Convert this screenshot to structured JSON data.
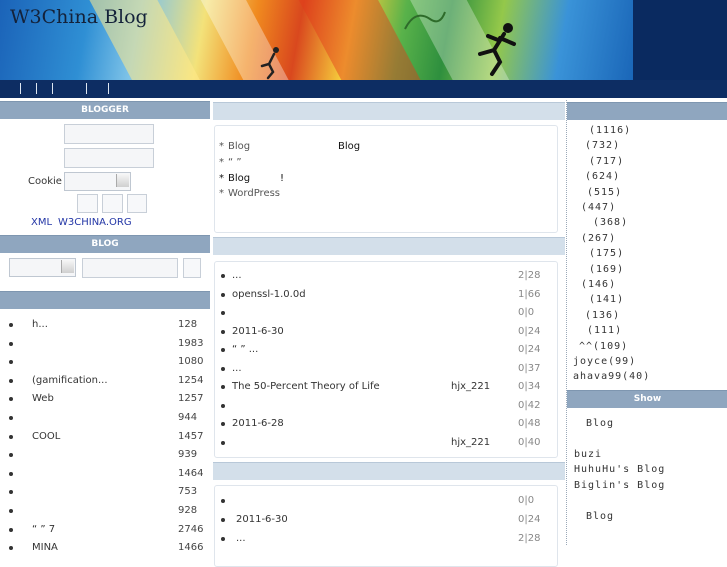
{
  "header": {
    "title": "W3China  Blog",
    "nav_separators": 5
  },
  "blogger": {
    "heading": "BLOGGER",
    "cookie_label": "Cookie",
    "xml_link": "XML",
    "site_link": "W3CHINA.ORG"
  },
  "blog_search": {
    "heading": "BLOG"
  },
  "left_list": [
    {
      "text": "h...",
      "count": "128"
    },
    {
      "text": "",
      "count": "1983"
    },
    {
      "text": "",
      "count": "1080"
    },
    {
      "text": "(gamification...",
      "count": "1254"
    },
    {
      "text": "Web",
      "count": "1257"
    },
    {
      "text": "",
      "count": "944"
    },
    {
      "text": "COOL",
      "count": "1457"
    },
    {
      "text": "",
      "count": "939"
    },
    {
      "text": "",
      "count": "1464"
    },
    {
      "text": "",
      "count": "753"
    },
    {
      "text": "",
      "count": "928"
    },
    {
      "text": "“  ” 7",
      "count": "2746"
    },
    {
      "text": "MINA",
      "count": "1466"
    }
  ],
  "notice": {
    "lines": [
      {
        "bullet": "*",
        "a": "Blog",
        "b": "Blog"
      },
      {
        "bullet": "*",
        "a": "“     ”",
        "b": ""
      },
      {
        "bullet": "*",
        "a": "Blog",
        "b": "!"
      },
      {
        "bullet": "*",
        "a": "WordPress",
        "b": ""
      }
    ]
  },
  "articles": [
    {
      "title": "...",
      "author": "",
      "stats": "2|28"
    },
    {
      "title": "openssl-1.0.0d",
      "author": "",
      "stats": "1|66"
    },
    {
      "title": "",
      "author": "",
      "stats": "0|0"
    },
    {
      "title": "2011-6-30",
      "author": "",
      "stats": "0|24"
    },
    {
      "title": "“  ”      ...",
      "author": "",
      "stats": "0|24"
    },
    {
      "title": "...",
      "author": "",
      "stats": "0|37"
    },
    {
      "title": "The 50-Percent Theory of Life",
      "author": "hjx_221",
      "stats": "0|34"
    },
    {
      "title": "",
      "author": "",
      "stats": "0|42"
    },
    {
      "title": "2011-6-28",
      "author": "",
      "stats": "0|48"
    },
    {
      "title": "",
      "author": "hjx_221",
      "stats": "0|40"
    }
  ],
  "articles2": [
    {
      "title": "",
      "stats": "0|0"
    },
    {
      "title": "2011-6-30",
      "stats": "0|24"
    },
    {
      "title": "...",
      "stats": "2|28"
    }
  ],
  "rank": [
    "(1116)",
    "(732)",
    "(717)",
    "(624)",
    "(515)",
    "(447)",
    "(368)",
    "(267)",
    "(175)",
    "(169)",
    "(146)",
    "(141)",
    "(136)",
    "(111)",
    "^^(109)",
    "joyce(99)",
    "ahava99(40)"
  ],
  "show": {
    "heading": "Show",
    "items": [
      "Blog",
      "",
      "buzi",
      "HuhuHu's Blog",
      "Biglin's Blog",
      "",
      "Blog"
    ]
  }
}
